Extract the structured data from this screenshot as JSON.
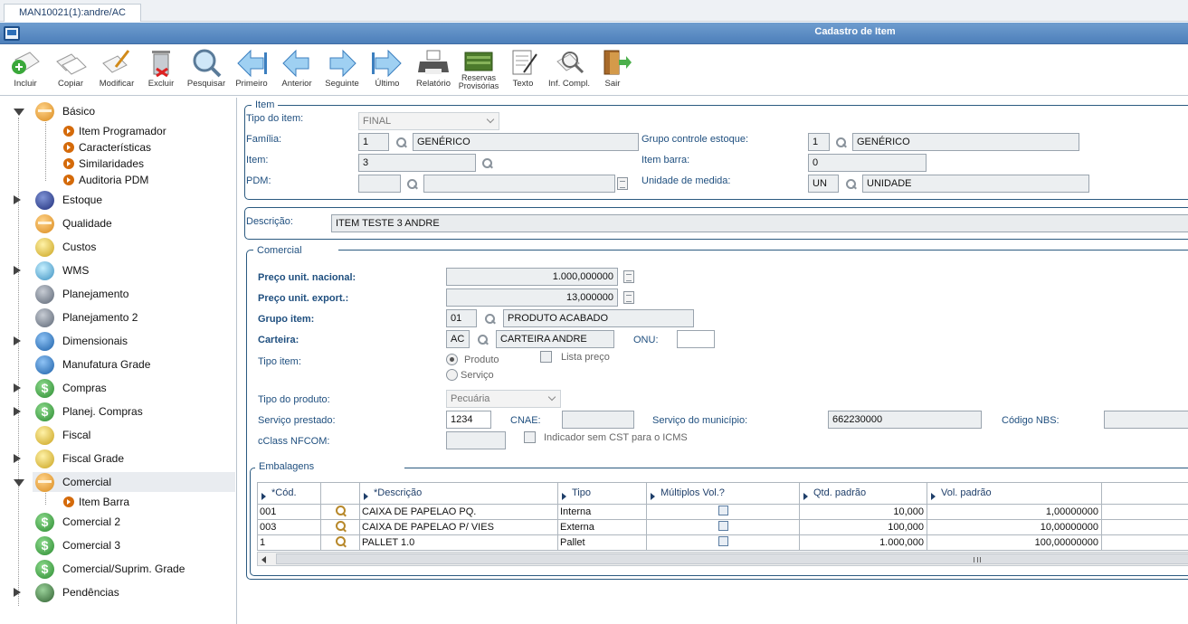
{
  "tab": {
    "label": "MAN10021(1):andre/AC"
  },
  "window": {
    "title": "Cadastro de Item"
  },
  "toolbar": {
    "buttons": [
      {
        "label": "Incluir",
        "icon": "add-document-icon"
      },
      {
        "label": "Copiar",
        "icon": "copy-icon"
      },
      {
        "label": "Modificar",
        "icon": "edit-icon"
      },
      {
        "label": "Excluir",
        "icon": "trash-icon"
      },
      {
        "label": "Pesquisar",
        "icon": "search-icon"
      },
      {
        "label": "Primeiro",
        "icon": "first-icon"
      },
      {
        "label": "Anterior",
        "icon": "previous-icon"
      },
      {
        "label": "Seguinte",
        "icon": "next-icon"
      },
      {
        "label": "Último",
        "icon": "last-icon"
      },
      {
        "label": "Relatório",
        "icon": "printer-icon"
      },
      {
        "label": "Reservas",
        "label2": "Provisórias",
        "icon": "reservations-icon"
      },
      {
        "label": "Texto",
        "icon": "text-icon"
      },
      {
        "label": "Inf. Compl.",
        "icon": "info-search-icon"
      },
      {
        "label": "Sair",
        "icon": "exit-door-icon"
      }
    ]
  },
  "tree": {
    "basico": "Básico",
    "basico_children": [
      "Item Programador",
      "Características",
      "Similaridades",
      "Auditoria PDM"
    ],
    "estoque": "Estoque",
    "qualidade": "Qualidade",
    "custos": "Custos",
    "wms": "WMS",
    "planejamento": "Planejamento",
    "planejamento2": "Planejamento 2",
    "dimensionais": "Dimensionais",
    "manufatura": "Manufatura Grade",
    "compras": "Compras",
    "planej_compras": "Planej. Compras",
    "fiscal": "Fiscal",
    "fiscal_grade": "Fiscal Grade",
    "comercial": "Comercial",
    "comercial_children": [
      "Item Barra"
    ],
    "comercial2": "Comercial 2",
    "comercial3": "Comercial 3",
    "comercial_suprim": "Comercial/Suprim. Grade",
    "pendencias": "Pendências"
  },
  "item": {
    "legend": "Item",
    "tipo_label": "Tipo do item:",
    "tipo_value": "FINAL",
    "familia_label": "Família:",
    "familia_code": "1",
    "familia_desc": "GENÉRICO",
    "grupo_ctrl_label": "Grupo controle estoque:",
    "grupo_ctrl_code": "1",
    "grupo_ctrl_desc": "GENÉRICO",
    "item_label": "Item:",
    "item_value": "3",
    "item_barra_label": "Item barra:",
    "item_barra_value": "0",
    "pdm_label": "PDM:",
    "pdm_code": "",
    "pdm_desc": "",
    "unidade_label": "Unidade de medida:",
    "unidade_code": "UN",
    "unidade_desc": "UNIDADE"
  },
  "descricao": {
    "label": "Descrição:",
    "value": "ITEM TESTE 3 ANDRE"
  },
  "comercial": {
    "legend": "Comercial",
    "preco_nac_label": "Preço unit. nacional:",
    "preco_nac_value": "1.000,000000",
    "preco_exp_label": "Preço unit. export.:",
    "preco_exp_value": "13,000000",
    "grupo_item_label": "Grupo item:",
    "grupo_item_code": "01",
    "grupo_item_desc": "PRODUTO ACABADO",
    "carteira_label": "Carteira:",
    "carteira_code": "AC",
    "carteira_desc": "CARTEIRA ANDRE",
    "onu_label": "ONU:",
    "onu_value": "",
    "tipo_item_label": "Tipo item:",
    "produto_label": "Produto",
    "servico_label": "Serviço",
    "lista_preco_label": "Lista preço",
    "tipo_produto_label": "Tipo do produto:",
    "tipo_produto_value": "Pecuária",
    "servico_prestado_label": "Serviço prestado:",
    "servico_prestado_value": "1234",
    "cnae_label": "CNAE:",
    "cnae_value": "",
    "servico_municipio_label": "Serviço do município:",
    "servico_municipio_value": "662230000",
    "codigo_nbs_label": "Código NBS:",
    "codigo_nbs_value": "",
    "cclass_label": "cClass NFCOM:",
    "cclass_value": "",
    "indicador_label": "Indicador sem CST para o ICMS"
  },
  "embalagens": {
    "legend": "Embalagens",
    "columns": [
      "*Cód.",
      "",
      "*Descrição",
      "Tipo",
      "Múltiplos Vol.?",
      "Qtd. padrão",
      "Vol. padrão",
      ""
    ],
    "rows": [
      {
        "cod": "001",
        "descricao": "CAIXA DE PAPELAO PQ.",
        "tipo": "Interna",
        "qtd": "10,000",
        "vol": "1,00000000"
      },
      {
        "cod": "003",
        "descricao": "CAIXA DE PAPELAO P/ VIES",
        "tipo": "Externa",
        "qtd": "100,000",
        "vol": "10,00000000"
      },
      {
        "cod": "1",
        "descricao": "PALLET 1.0",
        "tipo": "Pallet",
        "qtd": "1.000,000",
        "vol": "100,00000000"
      }
    ]
  }
}
